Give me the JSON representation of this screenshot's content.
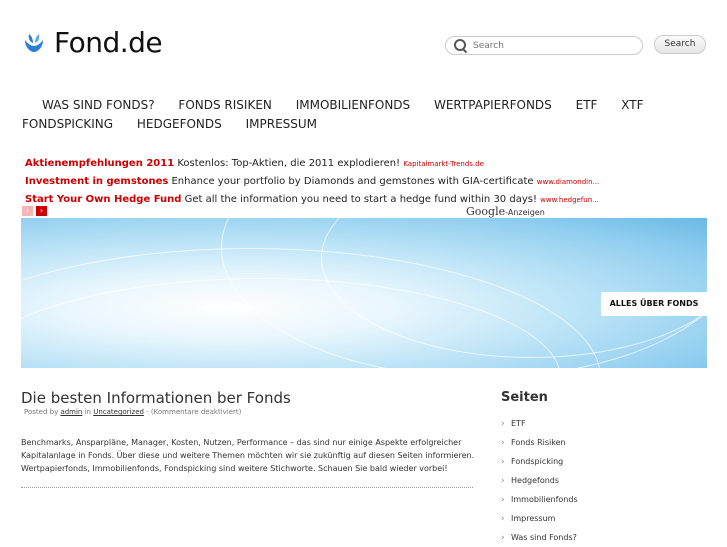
{
  "header": {
    "logo_text": "Fond.de",
    "search_placeholder": "Search",
    "search_button": "Search"
  },
  "nav": [
    "WAS SIND FONDS?",
    "FONDS RISIKEN",
    "IMMOBILIENFONDS",
    "WERTPAPIERFONDS",
    "ETF",
    "XTF",
    "FONDSPICKING",
    "HEDGEFONDS",
    "IMPRESSUM"
  ],
  "ads": [
    {
      "title": "Aktienempfehlungen 2011",
      "text": " Kostenlos: Top-Aktien, die 2011 explodieren! ",
      "url": "Kapitalmarkt-Trends.de"
    },
    {
      "title": "Investment in gemstones",
      "text": " Enhance your portfolio by Diamonds and gemstones with GIA-certificate ",
      "url": "www.diamondin..."
    },
    {
      "title": "Start Your Own Hedge Fund",
      "text": " Get all the information you need to start a hedge fund within 30 days! ",
      "url": "www.hedgefun..."
    }
  ],
  "ad_nav": {
    "prev": "‹",
    "next": "›"
  },
  "google": {
    "brand": "Google",
    "label": "-Anzeigen"
  },
  "banner": {
    "label": "ALLES ÜBER FONDS"
  },
  "post": {
    "title": "Die besten Informationen ber Fonds",
    "meta_prefix": "Posted by ",
    "author": "admin",
    "meta_in": " in ",
    "category": "Uncategorized",
    "meta_suffix": " - (Kommentare deaktiviert)",
    "body": "Benchmarks, Ansparpläne, Manager, Kosten, Nutzen, Performance – das sind nur einige Aspekte erfolgreicher Kapitalanlage in Fonds. Über diese und weitere Themen möchten wir sie zukünftig auf diesen Seiten informieren. Wertpapierfonds, Immobilienfonds, Fondspicking sind weitere Stichworte. Schauen Sie bald wieder vorbei!"
  },
  "sidebar": {
    "title": "Seiten",
    "items": [
      "ETF",
      "Fonds Risiken",
      "Fondspicking",
      "Hedgefonds",
      "Immobilienfonds",
      "Impressum",
      "Was sind Fonds?"
    ]
  }
}
